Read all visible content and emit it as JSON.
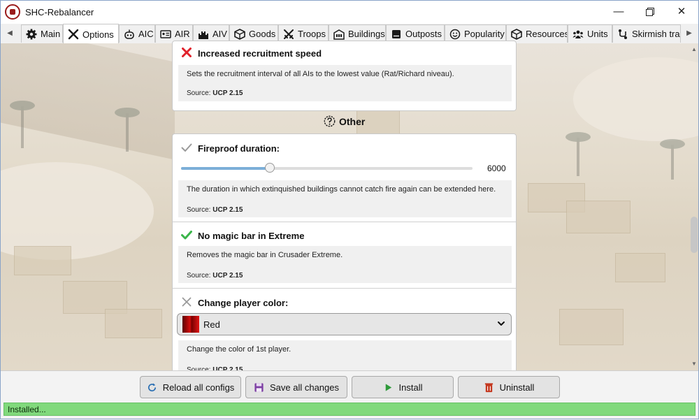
{
  "window": {
    "title": "SHC-Rebalancer",
    "logo_icon": "crusader-shield-icon",
    "minimize_icon": "minimize-icon",
    "maximize_icon": "maximize-icon",
    "close_icon": "close-icon"
  },
  "tabs": [
    {
      "label": "Main",
      "icon": "gear-icon",
      "active": false
    },
    {
      "label": "Options",
      "icon": "tools-icon",
      "active": true
    },
    {
      "label": "AIC",
      "icon": "robot-icon",
      "active": false
    },
    {
      "label": "AIR",
      "icon": "id-card-icon",
      "active": false
    },
    {
      "label": "AIV",
      "icon": "castle-icon",
      "active": false
    },
    {
      "label": "Goods",
      "icon": "box-icon",
      "active": false
    },
    {
      "label": "Troops",
      "icon": "crossed-swords-icon",
      "active": false
    },
    {
      "label": "Buildings",
      "icon": "building-icon",
      "active": false
    },
    {
      "label": "Outposts",
      "icon": "server-icon",
      "active": false
    },
    {
      "label": "Popularity",
      "icon": "smiley-icon",
      "active": false
    },
    {
      "label": "Resources",
      "icon": "cube-icon",
      "active": false
    },
    {
      "label": "Units",
      "icon": "users-icon",
      "active": false
    },
    {
      "label": "Skirmish trail",
      "icon": "route-icon",
      "active": false
    }
  ],
  "cards": {
    "recruitment": {
      "title": "Increased recruitment speed",
      "status": "disabled",
      "status_color": "#e0202a",
      "description": "Sets the recruitment interval of all AIs to the lowest value (Rat/Richard niveau).",
      "source_label": "Source:",
      "source_value": "UCP 2.15"
    },
    "section_other": {
      "label": "Other",
      "icon": "question-circle-icon"
    },
    "fireproof": {
      "title": "Fireproof duration:",
      "status": "neutral-check",
      "status_color": "#9a9a9a",
      "slider_value": "6000",
      "slider_fraction": 0.305,
      "description": "The duration in which extinquished buildings cannot catch fire again can be extended here.",
      "source_label": "Source:",
      "source_value": "UCP 2.15"
    },
    "magicbar": {
      "title": "No magic bar in Extreme",
      "status": "enabled",
      "status_color": "#3ab54a",
      "description": "Removes the magic bar in Crusader Extreme.",
      "source_label": "Source:",
      "source_value": "UCP 2.15"
    },
    "playercolor": {
      "title": "Change player color:",
      "status": "neutral-x",
      "status_color": "#9a9a9a",
      "selected": "Red",
      "description": "Change the color of 1st player.",
      "source_label": "Source:",
      "source_value": "UCP 2.15"
    }
  },
  "footer": {
    "reload_label": "Reload all configs",
    "save_label": "Save all changes",
    "install_label": "Install",
    "uninstall_label": "Uninstall",
    "reload_color": "#2a6fb3",
    "save_color": "#7d3fa3",
    "install_color": "#2e9a3a",
    "uninstall_color": "#c4371e"
  },
  "status": {
    "text": "Installed...",
    "color": "#81d97c"
  }
}
